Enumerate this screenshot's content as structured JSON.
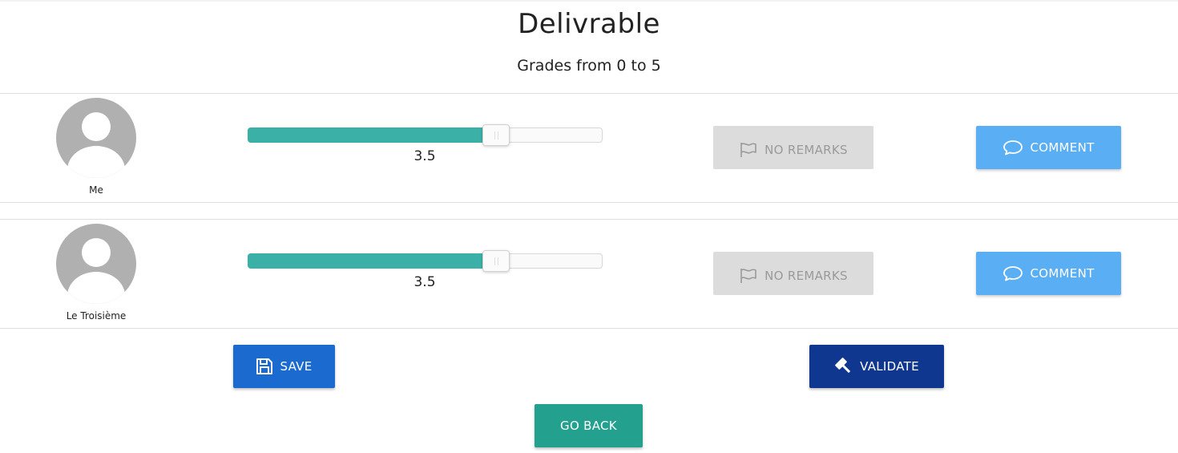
{
  "page": {
    "title": "Delivrable",
    "subtitle": "Grades from 0 to 5"
  },
  "colors": {
    "slider_fill": "#3ab0a6",
    "remarks_button": "#dcdcdc",
    "comment_button": "#5aaef3",
    "save_button": "#1a6ad0",
    "validate_button": "#10378f",
    "go_back_button": "#23a08e"
  },
  "grades": [
    {
      "name": "Me",
      "grade": 3.5,
      "grade_text": "3.5",
      "grade_min": 0,
      "grade_max": 5,
      "remarks_label": "NO REMARKS",
      "remarks_icon": "flag-icon",
      "comment_label": "COMMENT",
      "comment_icon": "speech-bubble-icon"
    },
    {
      "name": "Le Troisième",
      "grade": 3.5,
      "grade_text": "3.5",
      "grade_min": 0,
      "grade_max": 5,
      "remarks_label": "NO REMARKS",
      "remarks_icon": "flag-icon",
      "comment_label": "COMMENT",
      "comment_icon": "speech-bubble-icon"
    }
  ],
  "actions": {
    "save_label": "SAVE",
    "save_icon": "floppy-disk-icon",
    "validate_label": "VALIDATE",
    "validate_icon": "gavel-icon",
    "go_back_label": "GO BACK"
  }
}
